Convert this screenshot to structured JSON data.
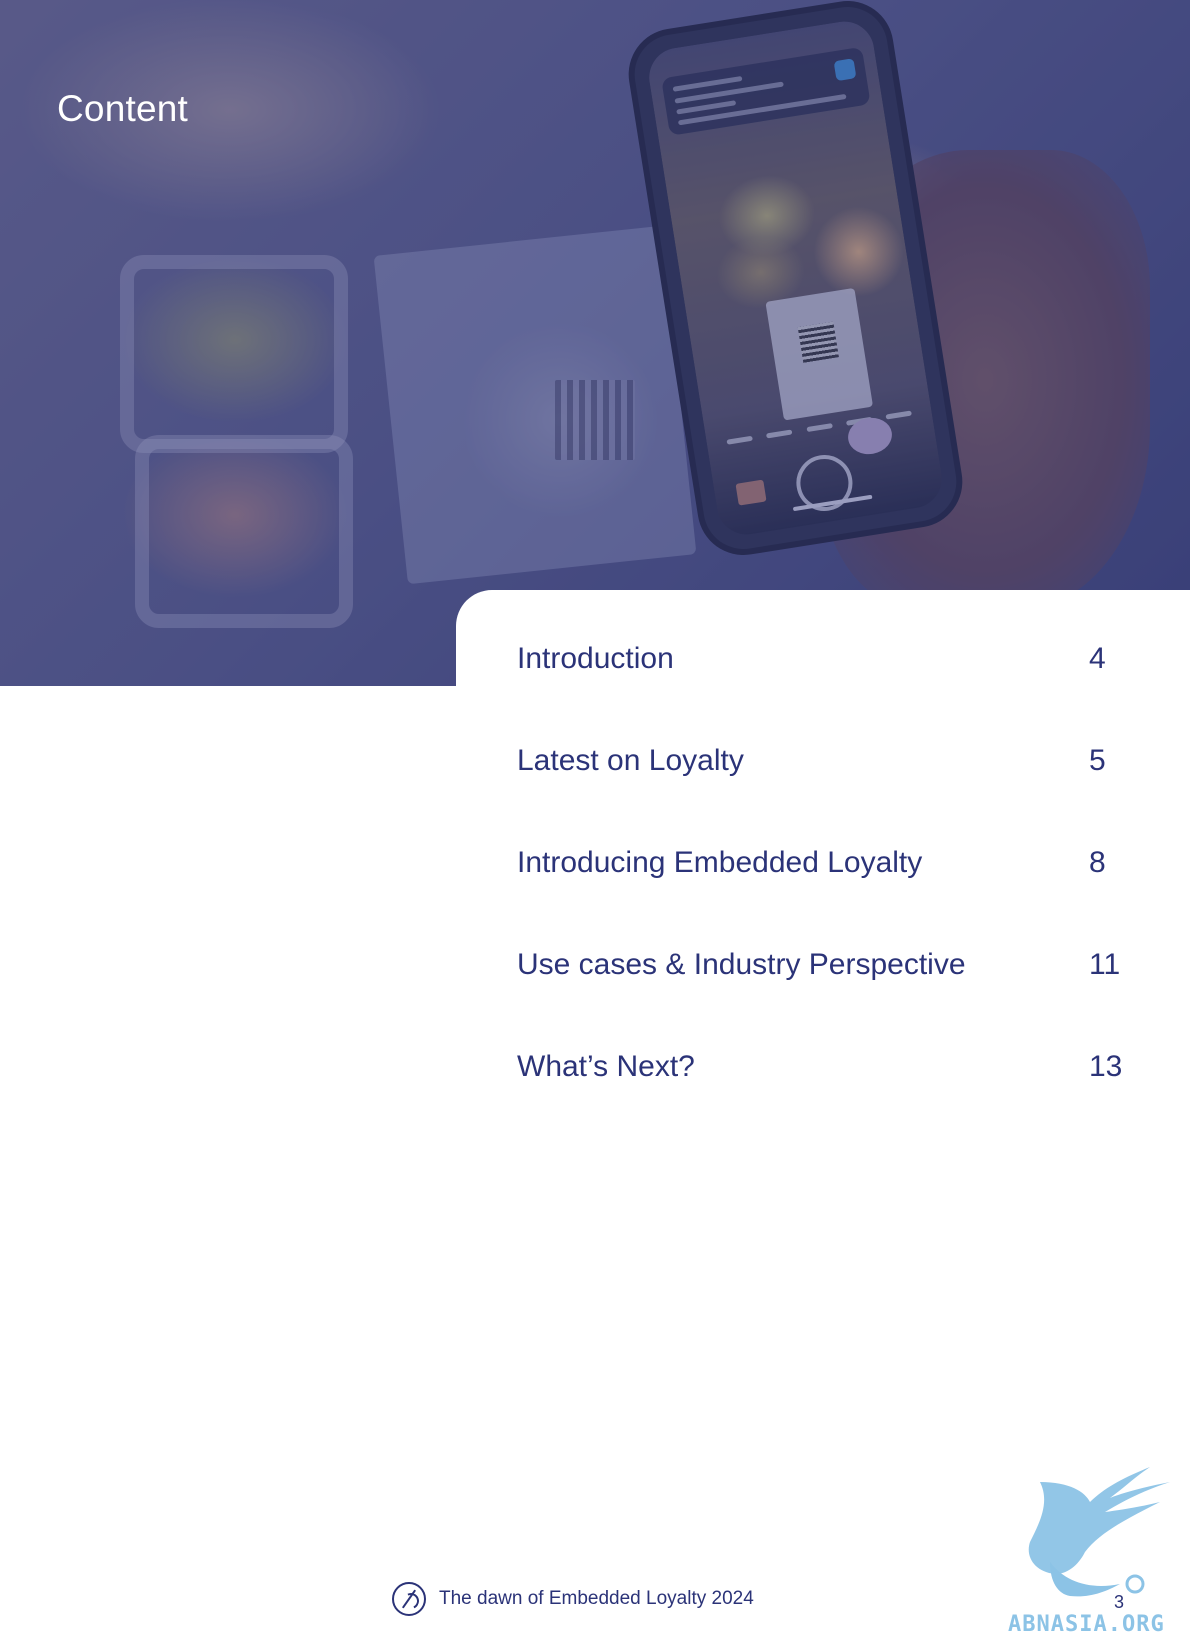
{
  "header": {
    "title": "Content"
  },
  "toc": [
    {
      "title": "Introduction",
      "page": "4"
    },
    {
      "title": "Latest on Loyalty",
      "page": "5"
    },
    {
      "title": "Introducing Embedded Loyalty",
      "page": "8"
    },
    {
      "title": "Use cases & Industry Perspective",
      "page": "11"
    },
    {
      "title": "What’s Next?",
      "page": "13"
    }
  ],
  "footer": {
    "document_title": "The dawn of Embedded Loyalty 2024",
    "page_number": "3",
    "logo_icon": "loyalty-logo-icon"
  },
  "watermark": {
    "text": "ABNASIA.ORG",
    "icon": "griffin-icon"
  },
  "colors": {
    "accent": "#2b3378",
    "overlay": "#373e87",
    "watermark": "#8cc3e6"
  }
}
